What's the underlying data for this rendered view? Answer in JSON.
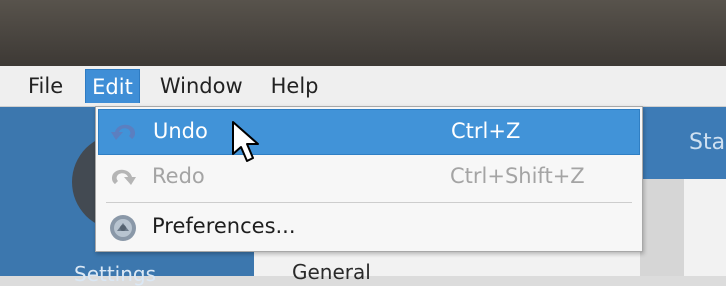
{
  "menubar": {
    "items": [
      {
        "label": "File",
        "active": false
      },
      {
        "label": "Edit",
        "active": true
      },
      {
        "label": "Window",
        "active": false
      },
      {
        "label": "Help",
        "active": false
      }
    ]
  },
  "edit_menu": {
    "items": [
      {
        "label": "Undo",
        "shortcut": "Ctrl+Z",
        "icon": "undo-icon",
        "state": "highlighted"
      },
      {
        "label": "Redo",
        "shortcut": "Ctrl+Shift+Z",
        "icon": "redo-icon",
        "state": "disabled"
      },
      {
        "label": "Preferences...",
        "shortcut": "",
        "icon": "preferences-icon",
        "state": "normal"
      }
    ]
  },
  "background_app": {
    "sidebar_label": "Settings",
    "header_label": "Sta",
    "content_label": "General"
  },
  "colors": {
    "accent": "#4193d8",
    "app_header": "#3d7bb6",
    "titlebar": "#45413c"
  }
}
